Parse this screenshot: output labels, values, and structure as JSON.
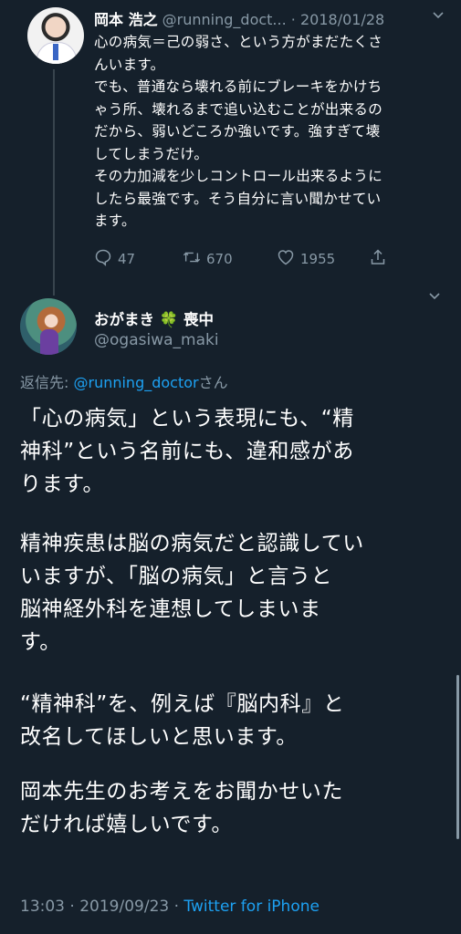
{
  "parent_tweet": {
    "name": "岡本 浩之",
    "handle": "@running_doct...",
    "separator": "·",
    "date": "2018/01/28",
    "text_lines": [
      "心の病気＝己の弱さ、という方がまだたくさ",
      "んいます。",
      "でも、普通なら壊れる前にブレーキをかけち",
      "ゃう所、壊れるまで追い込むことが出来るの",
      "だから、弱いどころか強いです。強すぎて壊",
      "してしまうだけ。",
      "その力加減を少しコントロール出来るように",
      "したら最強です。そう自分に言い聞かせてい",
      "ます。"
    ],
    "reply_count": "47",
    "retweet_count": "670",
    "like_count": "1955"
  },
  "main_tweet": {
    "name": "おがまき",
    "clover": "🍀",
    "name_suffix": "喪中",
    "handle": "@ogasiwa_maki",
    "reply_prefix": "返信先: ",
    "reply_handle": "@running_doctor",
    "reply_suffix": "さん",
    "paragraphs": [
      [
        "「心の病気」という表現にも、“精",
        "神科”という名前にも、違和感があ",
        "ります。"
      ],
      [
        "精神疾患は脳の病気だと認識してい",
        "いますが、「脳の病気」と言うと",
        "脳神経外科を連想してしまいま",
        "す。"
      ],
      [
        "“精神科”を、例えば『脳内科』と",
        "改名してほしいと思います。"
      ],
      [
        "岡本先生のお考えをお聞かせいた",
        "だければ嬉しいです。"
      ]
    ],
    "time": "13:03",
    "separator": "·",
    "date": "2019/09/23",
    "source_separator": "·",
    "source": "Twitter for iPhone"
  },
  "icons": {
    "menu": "chevron-down-icon",
    "reply": "comment-icon",
    "retweet": "retweet-icon",
    "like": "heart-icon",
    "share": "share-icon"
  },
  "colors": {
    "background": "#15202b",
    "muted": "#8899a6",
    "link": "#1da1f2",
    "text": "#ffffff"
  }
}
